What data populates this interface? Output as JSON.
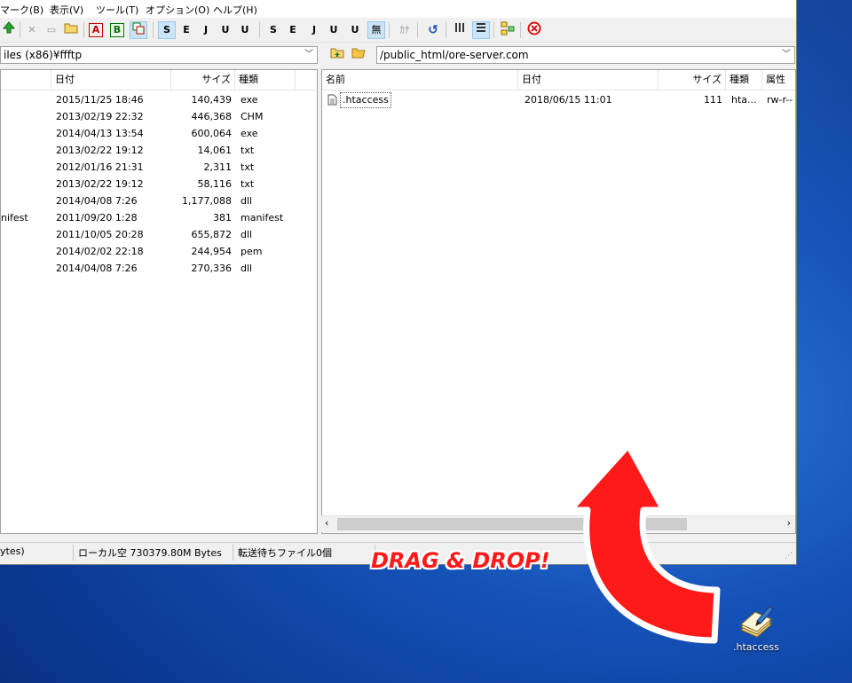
{
  "menu": [
    "マーク(B)",
    "表示(V)",
    "ツール(T)",
    "オプション(O)",
    "ヘルプ(H)"
  ],
  "toolbar": {
    "a_label": "A",
    "b_label": "B",
    "s_label": "S",
    "e_label": "E",
    "j_label": "J",
    "u8_label": "U",
    "u16_label": "U",
    "s2_label": "S",
    "e2_label": "E",
    "j2_label": "J",
    "u82_label": "U",
    "u162_label": "U",
    "mu_label": "無",
    "kana_label": "ｶﾅ"
  },
  "local": {
    "path": "iles (x86)¥ffftp",
    "headers": {
      "date": "日付",
      "size": "サイズ",
      "type": "種類"
    },
    "files": [
      {
        "name": "",
        "date": "2015/11/25 18:46",
        "size": "140,439",
        "type": "exe"
      },
      {
        "name": "",
        "date": "2013/02/19 22:32",
        "size": "446,368",
        "type": "CHM"
      },
      {
        "name": "",
        "date": "2014/04/13 13:54",
        "size": "600,064",
        "type": "exe"
      },
      {
        "name": "",
        "date": "2013/02/22 19:12",
        "size": "14,061",
        "type": "txt"
      },
      {
        "name": "",
        "date": "2012/01/16 21:31",
        "size": "2,311",
        "type": "txt"
      },
      {
        "name": "",
        "date": "2013/02/22 19:12",
        "size": "58,116",
        "type": "txt"
      },
      {
        "name": "",
        "date": "2014/04/08  7:26",
        "size": "1,177,088",
        "type": "dll"
      },
      {
        "name": "nifest",
        "date": "2011/09/20  1:28",
        "size": "381",
        "type": "manifest"
      },
      {
        "name": "",
        "date": "2011/10/05 20:28",
        "size": "655,872",
        "type": "dll"
      },
      {
        "name": "",
        "date": "2014/02/02 22:18",
        "size": "244,954",
        "type": "pem"
      },
      {
        "name": "",
        "date": "2014/04/08  7:26",
        "size": "270,336",
        "type": "dll"
      }
    ]
  },
  "remote": {
    "path": "/public_html/ore-server.com",
    "headers": {
      "name": "名前",
      "date": "日付",
      "size": "サイズ",
      "type": "種類",
      "attr": "属性"
    },
    "files": [
      {
        "name": ".htaccess",
        "date": "2018/06/15 11:01",
        "size": "111",
        "type": "hta...",
        "attr": "rw-r--"
      }
    ]
  },
  "status": {
    "left": "ytes)",
    "local_free": "ローカル空 730379.80M Bytes",
    "queue": "転送待ちファイル0個"
  },
  "annotation": "DRAG & DROP!",
  "desktop": {
    "file_label": ".htaccess"
  },
  "colors": {
    "arrow": "#ff1a1a",
    "selection": "#cce4f7"
  }
}
